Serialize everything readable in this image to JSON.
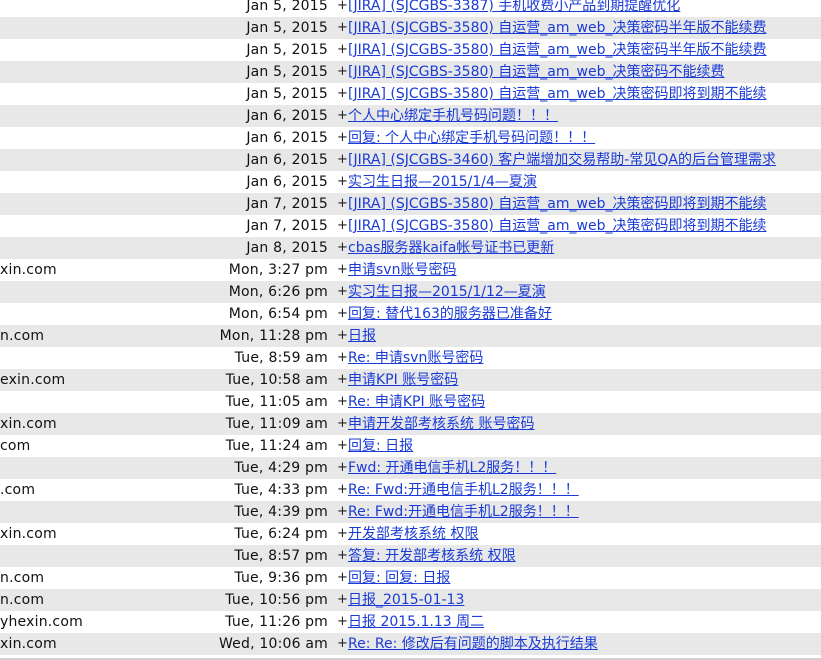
{
  "messages": [
    {
      "from": "",
      "date": "Jan 5, 2015",
      "subject": "[JIRA] (SJCGBS-3387) 手机收费小产品到期提醒优化"
    },
    {
      "from": "",
      "date": "Jan 5, 2015",
      "subject": "[JIRA] (SJCGBS-3580) 自运营_am_web_决策密码半年版不能续费"
    },
    {
      "from": "",
      "date": "Jan 5, 2015",
      "subject": "[JIRA] (SJCGBS-3580) 自运营_am_web_决策密码半年版不能续费"
    },
    {
      "from": "",
      "date": "Jan 5, 2015",
      "subject": "[JIRA] (SJCGBS-3580) 自运营_am_web_决策密码不能续费"
    },
    {
      "from": "",
      "date": "Jan 5, 2015",
      "subject": "[JIRA] (SJCGBS-3580) 自运营_am_web_决策密码即将到期不能续"
    },
    {
      "from": "",
      "date": "Jan 6, 2015",
      "subject": "个人中心绑定手机号码问题！！！"
    },
    {
      "from": "",
      "date": "Jan 6, 2015",
      "subject": "回复: 个人中心绑定手机号码问题！！！"
    },
    {
      "from": "",
      "date": "Jan 6, 2015",
      "subject": "[JIRA] (SJCGBS-3460) 客户端增加交易帮助-常见QA的后台管理需求"
    },
    {
      "from": "",
      "date": "Jan 6, 2015",
      "subject": "实习生日报—2015/1/4—夏演"
    },
    {
      "from": "",
      "date": "Jan 7, 2015",
      "subject": "[JIRA] (SJCGBS-3580) 自运营_am_web_决策密码即将到期不能续"
    },
    {
      "from": "",
      "date": "Jan 7, 2015",
      "subject": "[JIRA] (SJCGBS-3580) 自运营_am_web_决策密码即将到期不能续"
    },
    {
      "from": "",
      "date": "Jan 8, 2015",
      "subject": "cbas服务器kaifa帐号证书已更新"
    },
    {
      "from": "xin.com",
      "date": "Mon, 3:27 pm",
      "subject": "申请svn账号密码"
    },
    {
      "from": "",
      "date": "Mon, 6:26 pm",
      "subject": "实习生日报—2015/1/12—夏演"
    },
    {
      "from": "",
      "date": "Mon, 6:54 pm",
      "subject": "回复: 替代163的服务器已准备好"
    },
    {
      "from": "n.com",
      "date": "Mon, 11:28 pm",
      "subject": "日报"
    },
    {
      "from": "",
      "date": "Tue, 8:59 am",
      "subject": "Re: 申请svn账号密码"
    },
    {
      "from": "exin.com",
      "date": "Tue, 10:58 am",
      "subject": "申请KPI 账号密码"
    },
    {
      "from": "",
      "date": "Tue, 11:05 am",
      "subject": "Re: 申请KPI 账号密码"
    },
    {
      "from": "xin.com",
      "date": "Tue, 11:09 am",
      "subject": "申请开发部考核系统 账号密码"
    },
    {
      "from": "com",
      "date": "Tue, 11:24 am",
      "subject": "回复: 日报"
    },
    {
      "from": "",
      "date": "Tue, 4:29 pm",
      "subject": "Fwd: 开通电信手机L2服务！！！"
    },
    {
      "from": ".com",
      "date": "Tue, 4:33 pm",
      "subject": "Re: Fwd:开通电信手机L2服务！！！"
    },
    {
      "from": "",
      "date": "Tue, 4:39 pm",
      "subject": "Re: Fwd:开通电信手机L2服务！！！"
    },
    {
      "from": "xin.com",
      "date": "Tue, 6:24 pm",
      "subject": "开发部考核系统 权限"
    },
    {
      "from": "",
      "date": "Tue, 8:57 pm",
      "subject": "答复: 开发部考核系统 权限"
    },
    {
      "from": "n.com",
      "date": "Tue, 9:36 pm",
      "subject": "回复: 回复: 日报"
    },
    {
      "from": "n.com",
      "date": "Tue, 10:56 pm",
      "subject": "日报_2015-01-13"
    },
    {
      "from": "yhexin.com",
      "date": "Tue, 11:26 pm",
      "subject": "日报 2015.1.13 周二"
    },
    {
      "from": "xin.com",
      "date": "Wed, 10:06 am",
      "subject": "Re: Re: 修改后有问题的脚本及执行结果"
    }
  ],
  "row_marker": "+"
}
